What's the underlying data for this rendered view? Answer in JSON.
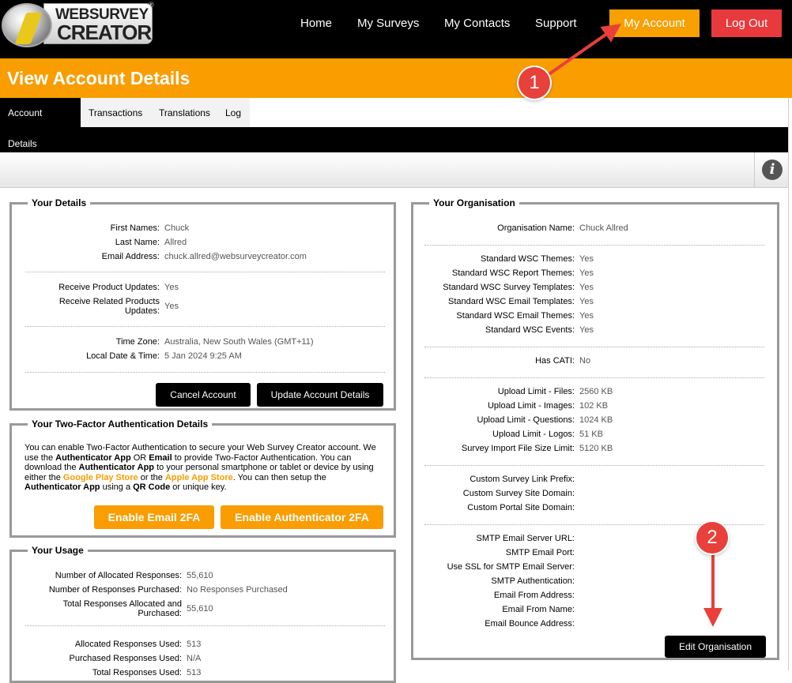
{
  "header": {
    "logo_line1": "WEBSURVEY",
    "logo_line2": "CREATOR",
    "logo_reg": "®",
    "nav": [
      "Home",
      "My Surveys",
      "My Contacts",
      "Support"
    ],
    "my_account": "My Account",
    "log_out": "Log Out"
  },
  "page_title": "View Account Details",
  "tabs": [
    "Account Details",
    "Transactions",
    "Translations",
    "Log"
  ],
  "info_icon": "i",
  "your_details": {
    "title": "Your Details",
    "rows": [
      {
        "label": "First Names:",
        "value": "Chuck"
      },
      {
        "label": "Last Name:",
        "value": "Allred"
      },
      {
        "label": "Email Address:",
        "value": "chuck.allred@websurveycreator.com"
      },
      {
        "label": "Receive Product Updates:",
        "value": "Yes"
      },
      {
        "label": "Receive Related Products Updates:",
        "value": "Yes"
      },
      {
        "label": "Time Zone:",
        "value": "Australia, New South Wales (GMT+11)"
      },
      {
        "label": "Local Date & Time:",
        "value": "5 Jan 2024 9:25 AM"
      }
    ],
    "cancel_button": "Cancel Account",
    "update_button": "Update Account Details"
  },
  "two_factor": {
    "title": "Your Two-Factor Authentication Details",
    "text_1": "You can enable Two-Factor Authentication to secure your Web Survey Creator account. We use the ",
    "bold_1": "Authenticator App",
    "text_2": " OR ",
    "bold_2": "Email",
    "text_3": " to provide Two-Factor Authentication. You can download the ",
    "bold_3": "Authenticator App",
    "text_4": " to your personal smartphone or tablet or device by using either the ",
    "link_google": "Google Play Store",
    "text_5": " or the ",
    "link_apple": "Apple App Store",
    "text_6": ". You can then setup the ",
    "bold_4": "Authenticator App",
    "text_7": " using a ",
    "bold_5": "QR Code",
    "text_8": " or unique key.",
    "email_button": "Enable Email 2FA",
    "auth_button": "Enable Authenticator 2FA"
  },
  "usage": {
    "title": "Your Usage",
    "rows": [
      {
        "label": "Number of Allocated Responses:",
        "value": "55,610"
      },
      {
        "label": "Number of Responses Purchased:",
        "value": "No Responses Purchased"
      },
      {
        "label": "Total Responses Allocated and Purchased:",
        "value": "55,610"
      },
      {
        "label": "Allocated Responses Used:",
        "value": "513"
      },
      {
        "label": "Purchased Responses Used:",
        "value": "N/A"
      },
      {
        "label": "Total Responses Used:",
        "value": "513"
      }
    ]
  },
  "organisation": {
    "title": "Your Organisation",
    "rows": [
      {
        "label": "Organisation Name:",
        "value": "Chuck Allred"
      },
      {
        "label": "Standard WSC Themes:",
        "value": "Yes"
      },
      {
        "label": "Standard WSC Report Themes:",
        "value": "Yes"
      },
      {
        "label": "Standard WSC Survey Templates:",
        "value": "Yes"
      },
      {
        "label": "Standard WSC Email Templates:",
        "value": "Yes"
      },
      {
        "label": "Standard WSC Email Themes:",
        "value": "Yes"
      },
      {
        "label": "Standard WSC Events:",
        "value": "Yes"
      },
      {
        "label": "Has CATI:",
        "value": "No"
      },
      {
        "label": "Upload Limit - Files:",
        "value": "2560 KB"
      },
      {
        "label": "Upload Limit - Images:",
        "value": "102 KB"
      },
      {
        "label": "Upload Limit - Questions:",
        "value": "1024 KB"
      },
      {
        "label": "Upload Limit - Logos:",
        "value": "51 KB"
      },
      {
        "label": "Survey Import File Size Limit:",
        "value": "5120 KB"
      },
      {
        "label": "Custom Survey Link Prefix:",
        "value": ""
      },
      {
        "label": "Custom Survey Site Domain:",
        "value": ""
      },
      {
        "label": "Custom Portal Site Domain:",
        "value": ""
      },
      {
        "label": "SMTP Email Server URL:",
        "value": ""
      },
      {
        "label": "SMTP Email Port:",
        "value": ""
      },
      {
        "label": "Use SSL for SMTP Email Server:",
        "value": ""
      },
      {
        "label": "SMTP Authentication:",
        "value": ""
      },
      {
        "label": "Email From Address:",
        "value": ""
      },
      {
        "label": "Email From Name:",
        "value": ""
      },
      {
        "label": "Email Bounce Address:",
        "value": ""
      }
    ],
    "edit_button": "Edit Organisation"
  },
  "annotations": [
    "1",
    "2"
  ],
  "colors": {
    "orange": "#f99d00",
    "red": "#e83a3c",
    "black": "#000000"
  }
}
